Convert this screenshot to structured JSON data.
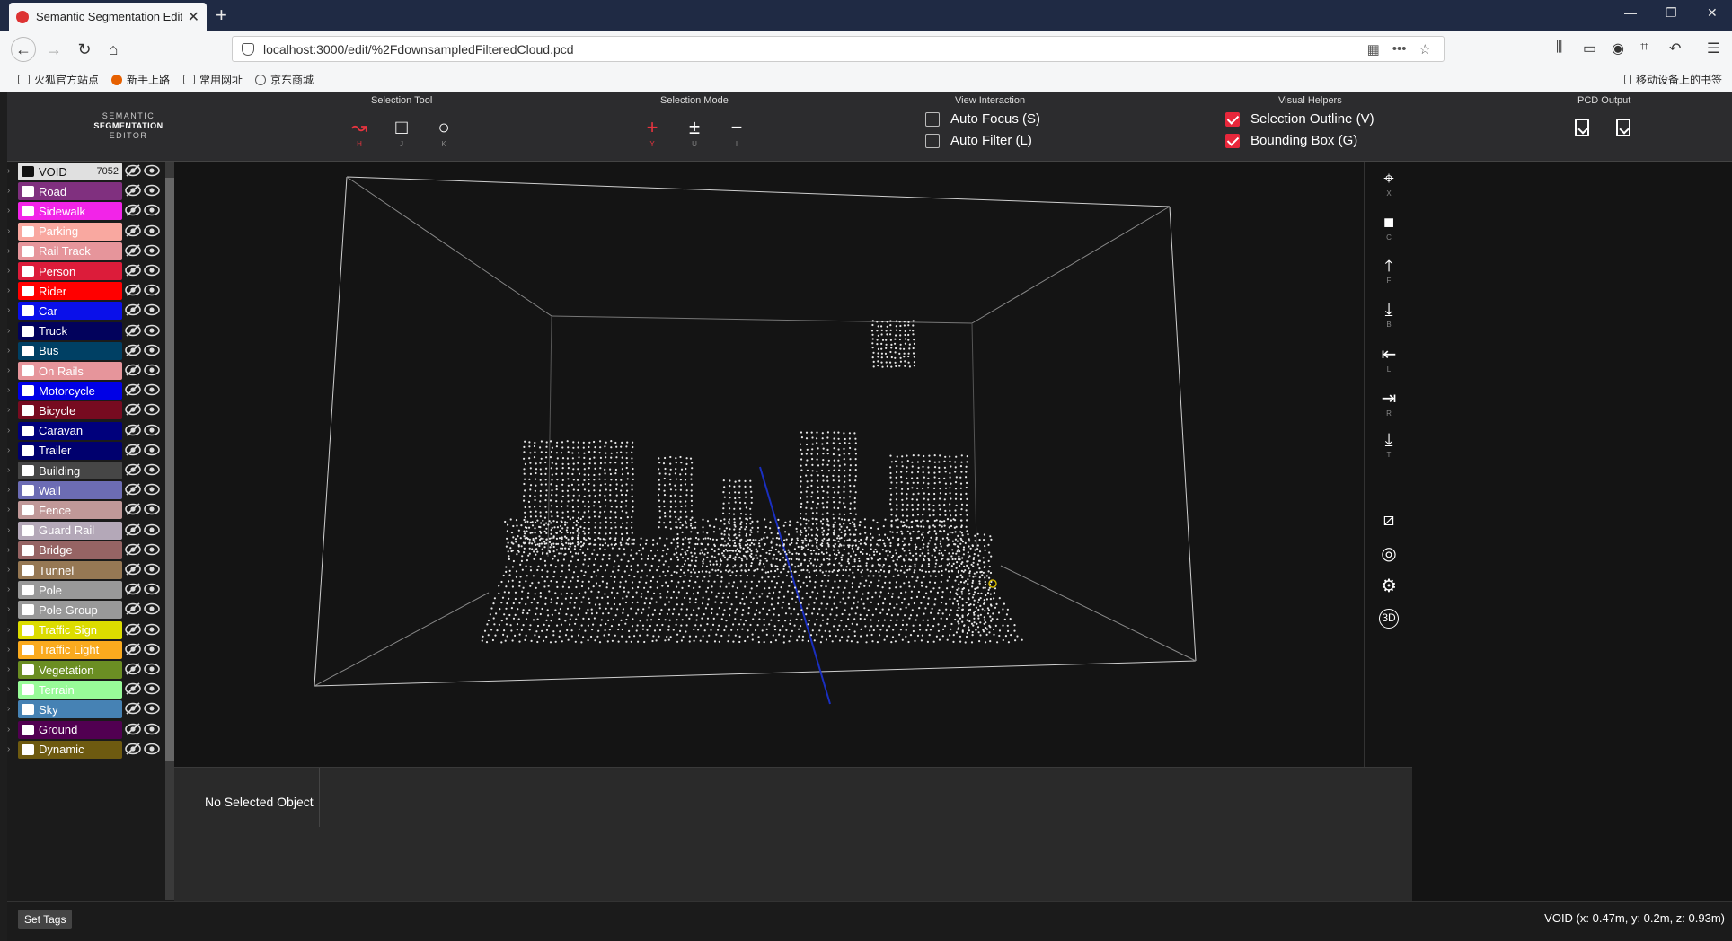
{
  "browser": {
    "tab_title": "Semantic Segmentation Edit",
    "new_tab": "+",
    "url": "localhost:3000/edit/%2FdownsampledFilteredCloud.pcd",
    "bookmarks": [
      "火狐官方站点",
      "新手上路",
      "常用网址",
      "京东商城"
    ],
    "mobile_bookmarks": "移动设备上的书签"
  },
  "app": {
    "logo_top": "SEMANTIC",
    "logo_mid": "SEGMENTATION",
    "logo_bottom": "EDITOR",
    "groups": {
      "selection_tool": "Selection Tool",
      "selection_mode": "Selection Mode",
      "view_interaction": "View Interaction",
      "visual_helpers": "Visual Helpers",
      "pcd_output": "PCD Output"
    },
    "tools": [
      {
        "key": "H",
        "icon": "lasso-icon"
      },
      {
        "key": "J",
        "icon": "rectangle-icon"
      },
      {
        "key": "K",
        "icon": "circle-icon"
      }
    ],
    "modes": [
      {
        "key": "Y",
        "glyph": "+"
      },
      {
        "key": "U",
        "glyph": "±"
      },
      {
        "key": "I",
        "glyph": "−"
      }
    ],
    "view_interaction": [
      {
        "label": "Auto Focus (S)",
        "checked": false
      },
      {
        "label": "Auto Filter (L)",
        "checked": false
      }
    ],
    "visual_helpers": [
      {
        "label": "Selection Outline (V)",
        "checked": true
      },
      {
        "label": "Bounding Box (G)",
        "checked": true
      }
    ],
    "accent_color": "#e8273b"
  },
  "categories": [
    {
      "name": "VOID",
      "color": "#e0e0e0",
      "dark_text": true,
      "count": "7052"
    },
    {
      "name": "Road",
      "color": "#80307f"
    },
    {
      "name": "Sidewalk",
      "color": "#f224e8"
    },
    {
      "name": "Parking",
      "color": "#f9a8a0"
    },
    {
      "name": "Rail Track",
      "color": "#e6959b"
    },
    {
      "name": "Person",
      "color": "#dc1c3a"
    },
    {
      "name": "Rider",
      "color": "#ff0000"
    },
    {
      "name": "Car",
      "color": "#0a10ea"
    },
    {
      "name": "Truck",
      "color": "#02025c"
    },
    {
      "name": "Bus",
      "color": "#004064"
    },
    {
      "name": "On Rails",
      "color": "#e6959b"
    },
    {
      "name": "Motorcycle",
      "color": "#0000e6"
    },
    {
      "name": "Bicycle",
      "color": "#770b20"
    },
    {
      "name": "Caravan",
      "color": "#00007c"
    },
    {
      "name": "Trailer",
      "color": "#00006e"
    },
    {
      "name": "Building",
      "color": "#464646"
    },
    {
      "name": "Wall",
      "color": "#6c6cb4"
    },
    {
      "name": "Fence",
      "color": "#c09898"
    },
    {
      "name": "Guard Rail",
      "color": "#b4a8b8"
    },
    {
      "name": "Bridge",
      "color": "#966464"
    },
    {
      "name": "Tunnel",
      "color": "#967854"
    },
    {
      "name": "Pole",
      "color": "#999999"
    },
    {
      "name": "Pole Group",
      "color": "#999999"
    },
    {
      "name": "Traffic Sign",
      "color": "#dcdc00"
    },
    {
      "name": "Traffic Light",
      "color": "#faaa1e"
    },
    {
      "name": "Vegetation",
      "color": "#6b8e23"
    },
    {
      "name": "Terrain",
      "color": "#98fb98"
    },
    {
      "name": "Sky",
      "color": "#4682b4"
    },
    {
      "name": "Ground",
      "color": "#510051"
    },
    {
      "name": "Dynamic",
      "color": "#6e5a10"
    }
  ],
  "right_tools": [
    {
      "key": "X",
      "icon": "crosshair-icon"
    },
    {
      "key": "C",
      "icon": "camera-icon"
    },
    {
      "key": "F",
      "icon": "view-front-icon"
    },
    {
      "key": "B",
      "icon": "view-back-icon"
    },
    {
      "key": "L",
      "icon": "view-left-icon"
    },
    {
      "key": "R",
      "icon": "view-right-icon"
    },
    {
      "key": "T",
      "icon": "view-top-icon"
    }
  ],
  "info": {
    "selection": "No Selected Object"
  },
  "status": {
    "set_tags": "Set Tags",
    "coords": "VOID (x: 0.47m, y: 0.2m, z: 0.93m)"
  }
}
